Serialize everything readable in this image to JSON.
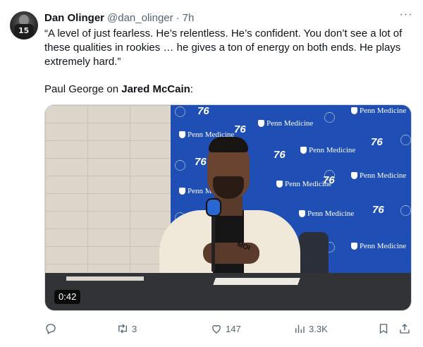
{
  "tweet": {
    "author_name": "Dan Olinger",
    "handle": "@dan_olinger",
    "separator": "·",
    "time": "7h",
    "more_label": "···",
    "avatar_number": "15",
    "text_quote": "“A level of just fearless. He’s relentless. He’s confident. You don’t see a lot of these qualities in rookies … he gives a ton of energy on both ends. He plays extremely hard.”",
    "text_attribution_prefix": "Paul George on ",
    "text_attribution_name": "Jared McCain",
    "text_attribution_suffix": ":"
  },
  "media": {
    "type": "video",
    "duration": "0:42",
    "backdrop_sponsor": "Penn Medicine",
    "backdrop_team_mark": "76",
    "shirt_text": "MOI"
  },
  "actions": {
    "reply": {
      "icon": "reply-icon",
      "count": ""
    },
    "retweet": {
      "icon": "retweet-icon",
      "count": "3"
    },
    "like": {
      "icon": "heart-icon",
      "count": "147"
    },
    "views": {
      "icon": "views-icon",
      "count": "3.3K"
    },
    "bookmark": {
      "icon": "bookmark-icon",
      "count": ""
    },
    "share": {
      "icon": "share-icon",
      "count": ""
    }
  },
  "colors": {
    "text_primary": "#0f1419",
    "text_secondary": "#536471",
    "backdrop_blue": "#1f4eb4",
    "team_red": "#e04a4a"
  }
}
